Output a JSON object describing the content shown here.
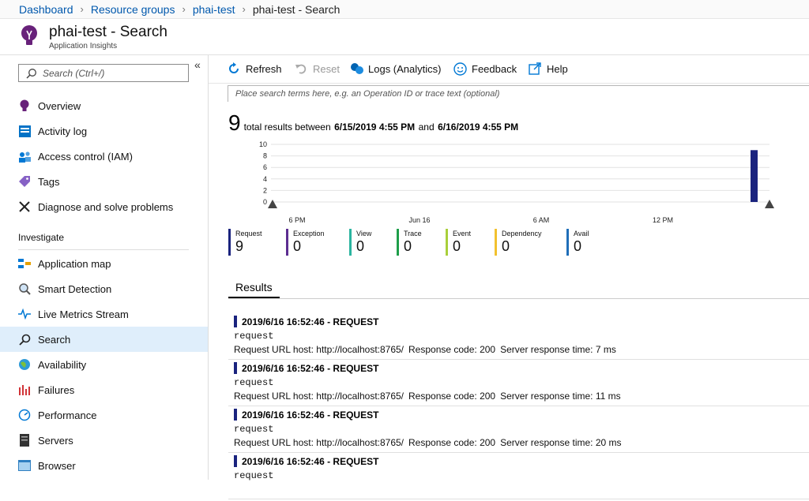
{
  "breadcrumb": [
    "Dashboard",
    "Resource groups",
    "phai-test",
    "phai-test - Search"
  ],
  "header": {
    "title": "phai-test - Search",
    "subtitle": "Application Insights"
  },
  "sidebar": {
    "search_placeholder": "Search (Ctrl+/)",
    "collapse": "«",
    "items": [
      {
        "label": "Overview",
        "icon": "lightbulb-icon"
      },
      {
        "label": "Activity log",
        "icon": "activity-log-icon"
      },
      {
        "label": "Access control (IAM)",
        "icon": "people-icon"
      },
      {
        "label": "Tags",
        "icon": "tag-icon"
      },
      {
        "label": "Diagnose and solve problems",
        "icon": "wrench-icon"
      }
    ],
    "section": "Investigate",
    "investigate_items": [
      {
        "label": "Application map",
        "icon": "app-map-icon"
      },
      {
        "label": "Smart Detection",
        "icon": "smart-detection-icon"
      },
      {
        "label": "Live Metrics Stream",
        "icon": "pulse-icon"
      },
      {
        "label": "Search",
        "icon": "search-icon",
        "active": true
      },
      {
        "label": "Availability",
        "icon": "globe-icon"
      },
      {
        "label": "Failures",
        "icon": "failures-icon"
      },
      {
        "label": "Performance",
        "icon": "performance-icon"
      },
      {
        "label": "Servers",
        "icon": "server-icon"
      },
      {
        "label": "Browser",
        "icon": "browser-icon"
      }
    ]
  },
  "toolbar": {
    "refresh": "Refresh",
    "reset": "Reset",
    "logs": "Logs (Analytics)",
    "feedback": "Feedback",
    "help": "Help"
  },
  "query": {
    "placeholder": "Place search terms here, e.g. an Operation ID or trace text (optional)"
  },
  "summary": {
    "count": "9",
    "text1": "total results between",
    "start": "6/15/2019 4:55 PM",
    "text2": "and",
    "end": "6/16/2019 4:55 PM"
  },
  "chart_data": {
    "type": "bar",
    "y_ticks": [
      "10",
      "8",
      "6",
      "4",
      "2",
      "0"
    ],
    "ylim": [
      0,
      10
    ],
    "x_ticks": [
      "6 PM",
      "Jun 16",
      "6 AM",
      "12 PM"
    ],
    "series": [
      {
        "name": "Request",
        "color": "#1a237e"
      }
    ],
    "bars": [
      {
        "position": "end of range",
        "value": 9
      }
    ]
  },
  "legend": [
    {
      "name": "Request",
      "value": "9",
      "color": "#1a237e"
    },
    {
      "name": "Exception",
      "value": "0",
      "color": "#5c2d91"
    },
    {
      "name": "View",
      "value": "0",
      "color": "#2bb5a0"
    },
    {
      "name": "Trace",
      "value": "0",
      "color": "#1e9e4a"
    },
    {
      "name": "Event",
      "value": "0",
      "color": "#a9cf3a"
    },
    {
      "name": "Dependency",
      "value": "0",
      "color": "#f2c12e"
    },
    {
      "name": "Avail",
      "value": "0",
      "color": "#1f6eb8"
    }
  ],
  "results_tab": "Results",
  "results": [
    {
      "title": "2019/6/16 16:52:46 - REQUEST",
      "type": "request",
      "host": "Request URL host: http://localhost:8765/",
      "code": "Response code: 200",
      "time": "Server response time: 7 ms"
    },
    {
      "title": "2019/6/16 16:52:46 - REQUEST",
      "type": "request",
      "host": "Request URL host: http://localhost:8765/",
      "code": "Response code: 200",
      "time": "Server response time: 11 ms"
    },
    {
      "title": "2019/6/16 16:52:46 - REQUEST",
      "type": "request",
      "host": "Request URL host: http://localhost:8765/",
      "code": "Response code: 200",
      "time": "Server response time: 20 ms"
    },
    {
      "title": "2019/6/16 16:52:46 - REQUEST",
      "type": "request",
      "host": "",
      "code": "",
      "time": ""
    }
  ]
}
